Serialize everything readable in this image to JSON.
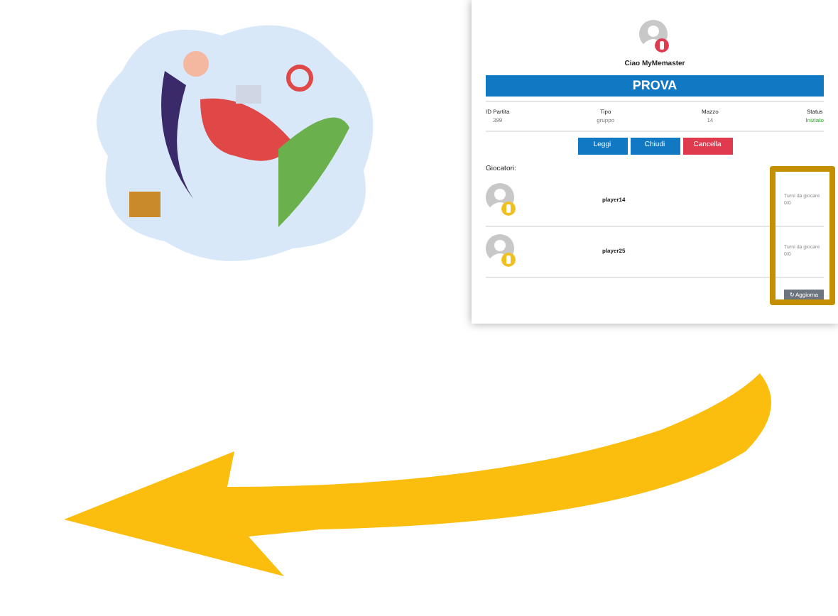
{
  "card": {
    "greeting": "Ciao MyMemaster",
    "title": "PROVA",
    "info": [
      {
        "label": "ID Partita",
        "value": "399",
        "kind": "plain"
      },
      {
        "label": "Tipo",
        "value": "gruppo",
        "kind": "plain"
      },
      {
        "label": "Mazzo",
        "value": "14",
        "kind": "plain"
      },
      {
        "label": "Status",
        "value": "Iniziato",
        "kind": "status"
      }
    ],
    "buttons": [
      {
        "label": "Leggi",
        "kind": "primary"
      },
      {
        "label": "Chiudi",
        "kind": "primary"
      },
      {
        "label": "Cancella",
        "kind": "danger"
      }
    ],
    "players_heading": "Giocatori:",
    "players": [
      {
        "name": "player14",
        "turns_label": "Turni da giocare",
        "turns": "0/0"
      },
      {
        "name": "player25",
        "turns_label": "Turni da giocare",
        "turns": "0/0"
      }
    ],
    "refresh_button": "↻ Aggiorna"
  }
}
